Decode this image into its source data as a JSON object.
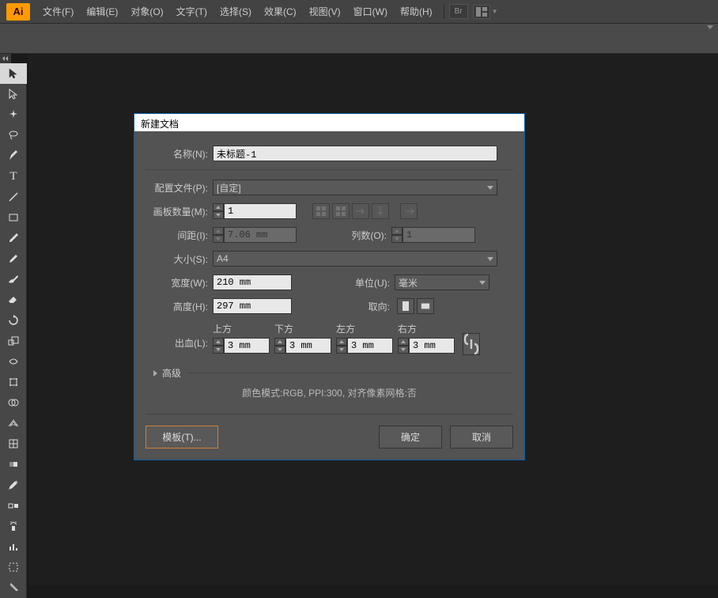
{
  "menubar": {
    "items": [
      "文件(F)",
      "编辑(E)",
      "对象(O)",
      "文字(T)",
      "选择(S)",
      "效果(C)",
      "视图(V)",
      "窗口(W)",
      "帮助(H)"
    ],
    "br": "Br"
  },
  "dialog": {
    "title": "新建文档",
    "name_label": "名称(N):",
    "name_value": "未标题-1",
    "profile_label": "配置文件(P):",
    "profile_value": "[自定]",
    "artboards_label": "画板数量(M):",
    "artboards_value": "1",
    "spacing_label": "间距(I):",
    "spacing_value": "7.06 mm",
    "cols_label": "列数(O):",
    "cols_value": "1",
    "size_label": "大小(S):",
    "size_value": "A4",
    "width_label": "宽度(W):",
    "width_value": "210 mm",
    "units_label": "单位(U):",
    "units_value": "毫米",
    "height_label": "高度(H):",
    "height_value": "297 mm",
    "orient_label": "取向:",
    "bleed_label": "出血(L):",
    "bleed": {
      "top": "上方",
      "bottom": "下方",
      "left": "左方",
      "right": "右方",
      "value": "3 mm"
    },
    "advanced": "高级",
    "info": "颜色模式:RGB, PPI:300, 对齐像素网格:否",
    "template_btn": "模板(T)...",
    "ok_btn": "确定",
    "cancel_btn": "取消"
  }
}
